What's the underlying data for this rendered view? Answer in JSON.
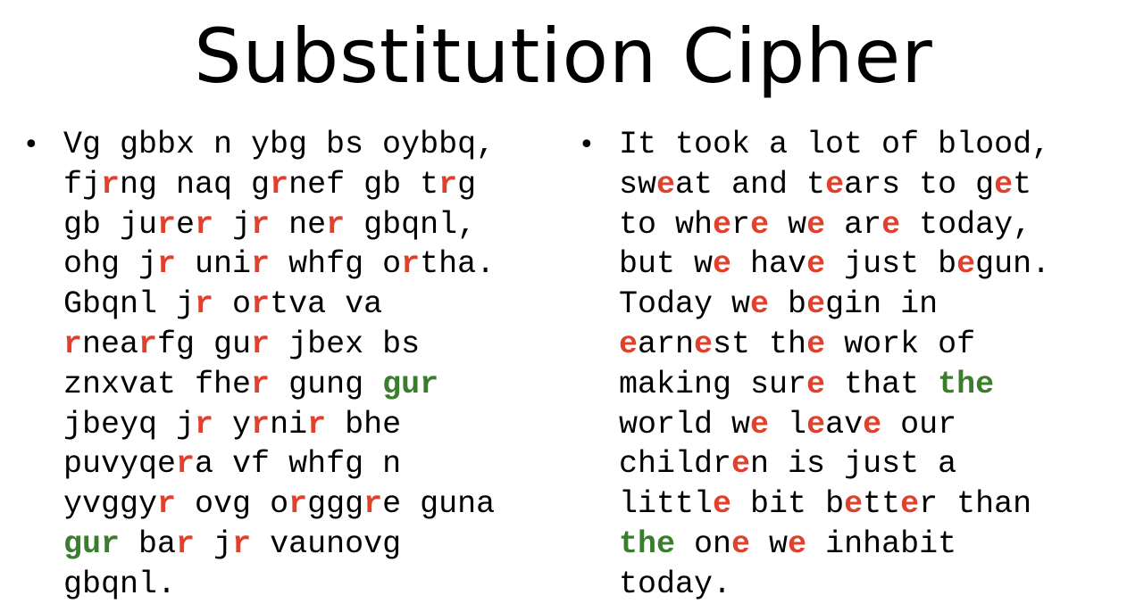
{
  "slide": {
    "title": "Substitution Cipher",
    "bullet_glyph": "•",
    "colors": {
      "highlight_red": "#e0402c",
      "highlight_green": "#3a7d2c",
      "text": "#000000"
    },
    "cipher_lines": [
      [
        {
          "t": "Vg gbbx n ybg bs oybbq,",
          "c": ""
        }
      ],
      [
        {
          "t": "fj",
          "c": ""
        },
        {
          "t": "r",
          "c": "red"
        },
        {
          "t": "ng naq g",
          "c": ""
        },
        {
          "t": "r",
          "c": "red"
        },
        {
          "t": "nef gb t",
          "c": ""
        },
        {
          "t": "r",
          "c": "red"
        },
        {
          "t": "g",
          "c": ""
        }
      ],
      [
        {
          "t": "gb ju",
          "c": ""
        },
        {
          "t": "r",
          "c": "red"
        },
        {
          "t": "e",
          "c": ""
        },
        {
          "t": "r",
          "c": "red"
        },
        {
          "t": " j",
          "c": ""
        },
        {
          "t": "r",
          "c": "red"
        },
        {
          "t": " ne",
          "c": ""
        },
        {
          "t": "r",
          "c": "red"
        },
        {
          "t": " gbqnl,",
          "c": ""
        }
      ],
      [
        {
          "t": "ohg j",
          "c": ""
        },
        {
          "t": "r",
          "c": "red"
        },
        {
          "t": " uni",
          "c": ""
        },
        {
          "t": "r",
          "c": "red"
        },
        {
          "t": " whfg o",
          "c": ""
        },
        {
          "t": "r",
          "c": "red"
        },
        {
          "t": "tha.",
          "c": ""
        }
      ],
      [
        {
          "t": "Gbqnl j",
          "c": ""
        },
        {
          "t": "r",
          "c": "red"
        },
        {
          "t": " o",
          "c": ""
        },
        {
          "t": "r",
          "c": "red"
        },
        {
          "t": "tva va",
          "c": ""
        }
      ],
      [
        {
          "t": "r",
          "c": "red"
        },
        {
          "t": "nea",
          "c": ""
        },
        {
          "t": "r",
          "c": "red"
        },
        {
          "t": "fg gu",
          "c": ""
        },
        {
          "t": "r",
          "c": "red"
        },
        {
          "t": " jbex bs",
          "c": ""
        }
      ],
      [
        {
          "t": "znxvat fhe",
          "c": ""
        },
        {
          "t": "r",
          "c": "red"
        },
        {
          "t": " gung ",
          "c": ""
        },
        {
          "t": "gur",
          "c": "green"
        }
      ],
      [
        {
          "t": "jbeyq j",
          "c": ""
        },
        {
          "t": "r",
          "c": "red"
        },
        {
          "t": " y",
          "c": ""
        },
        {
          "t": "r",
          "c": "red"
        },
        {
          "t": "ni",
          "c": ""
        },
        {
          "t": "r",
          "c": "red"
        },
        {
          "t": " bhe",
          "c": ""
        }
      ],
      [
        {
          "t": "puvyqe",
          "c": ""
        },
        {
          "t": "r",
          "c": "red"
        },
        {
          "t": "a vf whfg n",
          "c": ""
        }
      ],
      [
        {
          "t": "yvggy",
          "c": ""
        },
        {
          "t": "r",
          "c": "red"
        },
        {
          "t": " ovg o",
          "c": ""
        },
        {
          "t": "r",
          "c": "red"
        },
        {
          "t": "ggg",
          "c": ""
        },
        {
          "t": "r",
          "c": "red"
        },
        {
          "t": "e guna",
          "c": ""
        }
      ],
      [
        {
          "t": "gur",
          "c": "green"
        },
        {
          "t": " ba",
          "c": ""
        },
        {
          "t": "r",
          "c": "red"
        },
        {
          "t": " j",
          "c": ""
        },
        {
          "t": "r",
          "c": "red"
        },
        {
          "t": " vaunovg",
          "c": ""
        }
      ],
      [
        {
          "t": "gbqnl.",
          "c": ""
        }
      ]
    ],
    "plain_lines": [
      [
        {
          "t": "It took a lot of blood,",
          "c": ""
        }
      ],
      [
        {
          "t": "sw",
          "c": ""
        },
        {
          "t": "e",
          "c": "red"
        },
        {
          "t": "at and t",
          "c": ""
        },
        {
          "t": "e",
          "c": "red"
        },
        {
          "t": "ars to g",
          "c": ""
        },
        {
          "t": "e",
          "c": "red"
        },
        {
          "t": "t",
          "c": ""
        }
      ],
      [
        {
          "t": "to wh",
          "c": ""
        },
        {
          "t": "e",
          "c": "red"
        },
        {
          "t": "r",
          "c": ""
        },
        {
          "t": "e",
          "c": "red"
        },
        {
          "t": " w",
          "c": ""
        },
        {
          "t": "e",
          "c": "red"
        },
        {
          "t": " ar",
          "c": ""
        },
        {
          "t": "e",
          "c": "red"
        },
        {
          "t": " today,",
          "c": ""
        }
      ],
      [
        {
          "t": "but w",
          "c": ""
        },
        {
          "t": "e",
          "c": "red"
        },
        {
          "t": " hav",
          "c": ""
        },
        {
          "t": "e",
          "c": "red"
        },
        {
          "t": " just b",
          "c": ""
        },
        {
          "t": "e",
          "c": "red"
        },
        {
          "t": "gun.",
          "c": ""
        }
      ],
      [
        {
          "t": "Today w",
          "c": ""
        },
        {
          "t": "e",
          "c": "red"
        },
        {
          "t": " b",
          "c": ""
        },
        {
          "t": "e",
          "c": "red"
        },
        {
          "t": "gin in",
          "c": ""
        }
      ],
      [
        {
          "t": "e",
          "c": "red"
        },
        {
          "t": "arn",
          "c": ""
        },
        {
          "t": "e",
          "c": "red"
        },
        {
          "t": "st th",
          "c": ""
        },
        {
          "t": "e",
          "c": "red"
        },
        {
          "t": " work of",
          "c": ""
        }
      ],
      [
        {
          "t": "making sur",
          "c": ""
        },
        {
          "t": "e",
          "c": "red"
        },
        {
          "t": " that ",
          "c": ""
        },
        {
          "t": "the",
          "c": "green"
        }
      ],
      [
        {
          "t": "world w",
          "c": ""
        },
        {
          "t": "e",
          "c": "red"
        },
        {
          "t": " l",
          "c": ""
        },
        {
          "t": "e",
          "c": "red"
        },
        {
          "t": "av",
          "c": ""
        },
        {
          "t": "e",
          "c": "red"
        },
        {
          "t": " our",
          "c": ""
        }
      ],
      [
        {
          "t": "childr",
          "c": ""
        },
        {
          "t": "e",
          "c": "red"
        },
        {
          "t": "n is just a",
          "c": ""
        }
      ],
      [
        {
          "t": "littl",
          "c": ""
        },
        {
          "t": "e",
          "c": "red"
        },
        {
          "t": " bit b",
          "c": ""
        },
        {
          "t": "e",
          "c": "red"
        },
        {
          "t": "tt",
          "c": ""
        },
        {
          "t": "e",
          "c": "red"
        },
        {
          "t": "r than",
          "c": ""
        }
      ],
      [
        {
          "t": "the",
          "c": "green"
        },
        {
          "t": " on",
          "c": ""
        },
        {
          "t": "e",
          "c": "red"
        },
        {
          "t": " w",
          "c": ""
        },
        {
          "t": "e",
          "c": "red"
        },
        {
          "t": " inhabit",
          "c": ""
        }
      ],
      [
        {
          "t": "today.",
          "c": ""
        }
      ]
    ]
  }
}
